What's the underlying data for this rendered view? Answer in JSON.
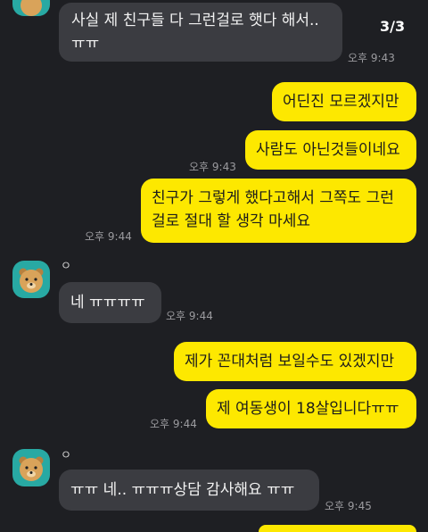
{
  "chat": {
    "page_counter": "3/3",
    "messages": [
      {
        "sender": "",
        "text": "사실 제 친구들 다 그런걸로 햇다 해서..\nㅠㅠ",
        "time": "오후 9:43"
      },
      {
        "text": "어딘진 모르겠지만"
      },
      {
        "text": "사람도 아닌것들이네요",
        "time": "오후 9:43"
      },
      {
        "text": "친구가 그렇게 했다고해서 그쪽도 그런\n걸로 절대 할 생각 마세요",
        "time": "오후 9:44"
      },
      {
        "sender": "ㅇ",
        "text": "네 ㅠㅠㅠㅠ",
        "time": "오후 9:44"
      },
      {
        "text": "제가 꼰대처럼 보일수도 있겠지만"
      },
      {
        "text": "제 여동생이 18살입니다ㅠㅠ",
        "time": "오후 9:44"
      },
      {
        "sender": "ㅇ",
        "text": "ㅠㅠ 네.. ㅠㅠㅠ상담 감사해요 ㅠㅠ",
        "time": "오후 9:45"
      }
    ]
  },
  "colors": {
    "background": "#1e1f23",
    "incoming_bubble": "#3b3c41",
    "outgoing_bubble": "#fde800",
    "avatar": "#28a9a3",
    "timestamp": "#9b9b9f"
  }
}
